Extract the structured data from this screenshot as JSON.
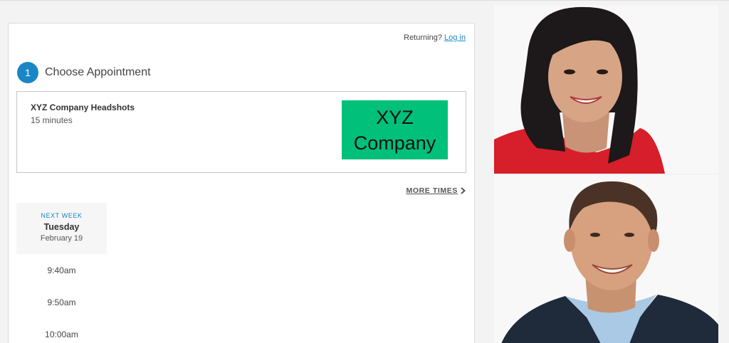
{
  "header": {
    "returning_text": "Returning?",
    "login_link": "Log in"
  },
  "step": {
    "number": "1",
    "title": "Choose Appointment"
  },
  "appointment": {
    "name": "XYZ Company Headshots",
    "duration": "15 minutes",
    "logo_line1": "XYZ",
    "logo_line2": "Company",
    "logo_color": "#00c07a"
  },
  "more_times": "MORE TIMES",
  "schedule": {
    "week_label": "NEXT WEEK",
    "day": "Tuesday",
    "date": "February 19",
    "slots": [
      "9:40am",
      "9:50am",
      "10:00am"
    ]
  },
  "colors": {
    "accent": "#1a86c6"
  }
}
